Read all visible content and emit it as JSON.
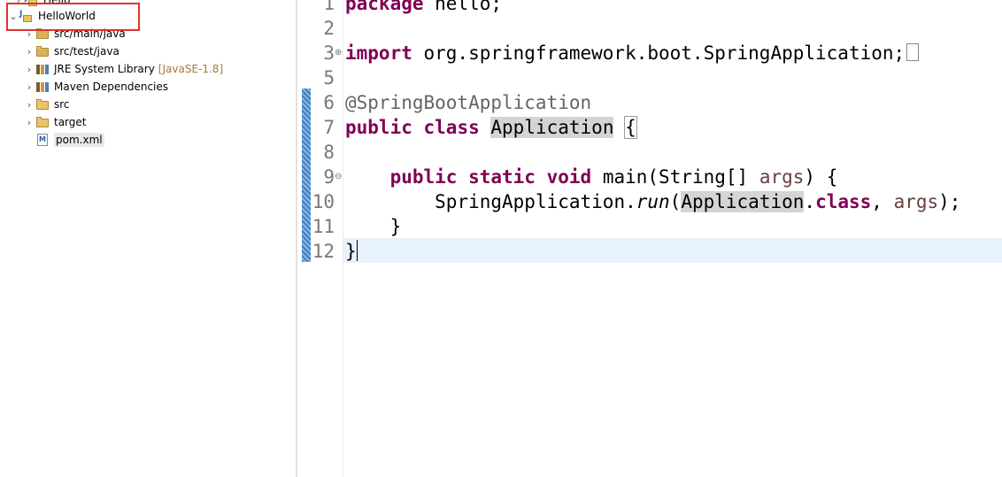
{
  "explorer": {
    "items": [
      {
        "label": "Hello"
      },
      {
        "label": "HelloWorld"
      },
      {
        "label": "src/main/java"
      },
      {
        "label": "src/test/java"
      },
      {
        "label": "JRE System Library",
        "decoration": "[JavaSE-1.8]"
      },
      {
        "label": "Maven Dependencies"
      },
      {
        "label": "src"
      },
      {
        "label": "target"
      },
      {
        "label": "pom.xml"
      }
    ],
    "highlight_color": "#e0312c"
  },
  "editor": {
    "line_numbers": [
      "1",
      "2",
      "3",
      "5",
      "6",
      "7",
      "8",
      "9",
      "10",
      "11",
      "12"
    ],
    "code": {
      "l1_kw": "package",
      "l1_rest": " hello;",
      "l3_kw": "import",
      "l3_rest": " org.springframework.boot.SpringApplication;",
      "l6_ann": "@SpringBootApplication",
      "l7_kw1": "public",
      "l7_kw2": "class",
      "l7_name": "Application",
      "l7_brace": "{",
      "l9_kw1": "public",
      "l9_kw2": "static",
      "l9_kw3": "void",
      "l9_mid": " main(String[] ",
      "l9_param": "args",
      "l9_end": ") {",
      "l10_class": "SpringApplication.",
      "l10_method": "run",
      "l10_open": "(",
      "l10_app": "Application",
      "l10_dot": ".",
      "l10_kw": "class",
      "l10_comma": ", ",
      "l10_param": "args",
      "l10_end": ");",
      "l11": "}",
      "l12": "}"
    },
    "colors": {
      "keyword": "#7f0055",
      "annotation": "#646464",
      "current_line": "#e8f2fe"
    }
  }
}
